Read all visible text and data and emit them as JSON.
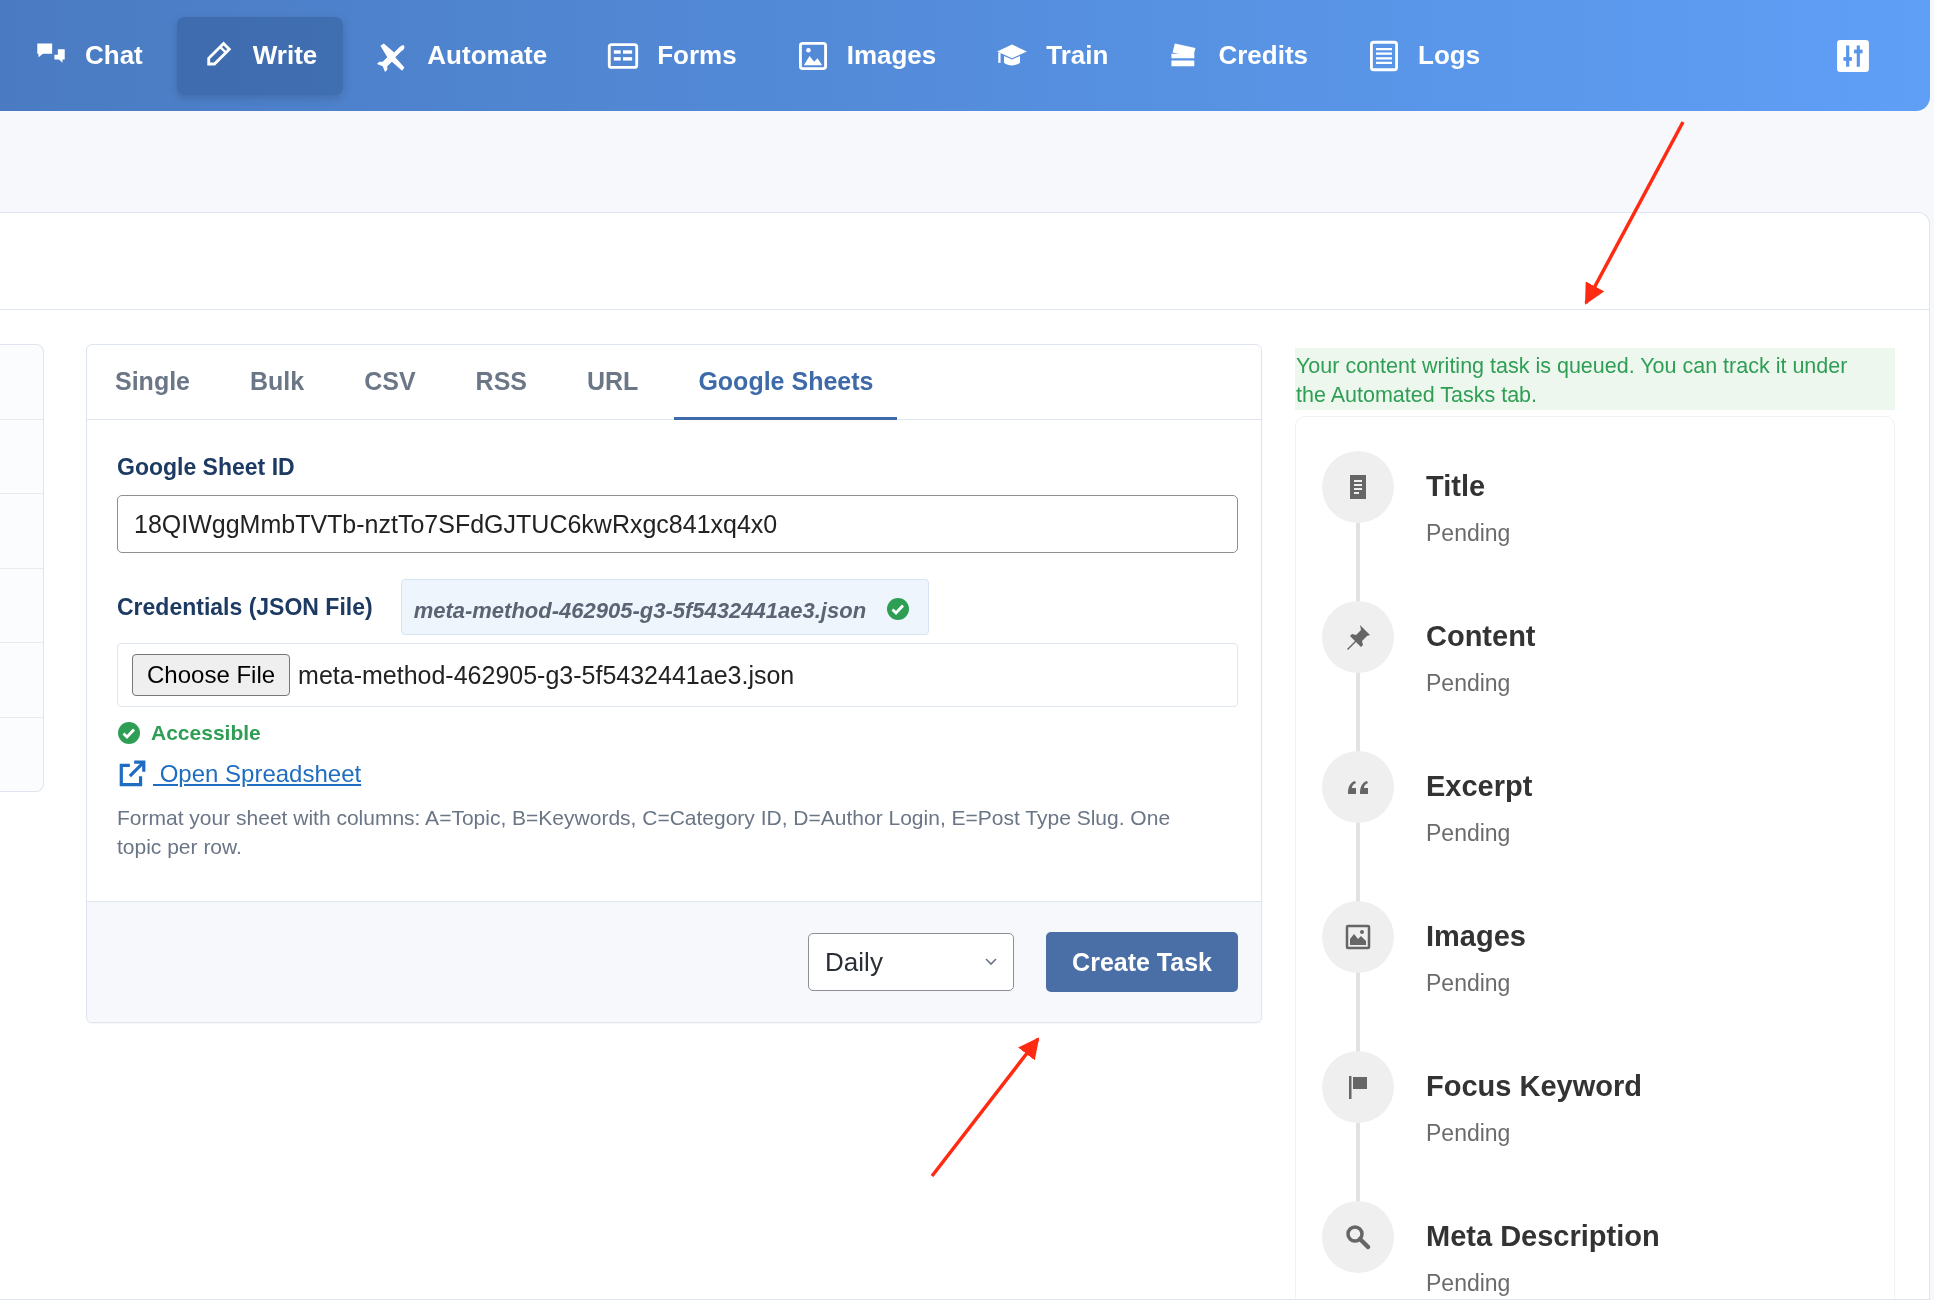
{
  "nav": {
    "items": [
      {
        "label": "Chat",
        "selected": false
      },
      {
        "label": "Write",
        "selected": true
      },
      {
        "label": "Automate",
        "selected": false
      },
      {
        "label": "Forms",
        "selected": false
      },
      {
        "label": "Images",
        "selected": false
      },
      {
        "label": "Train",
        "selected": false
      },
      {
        "label": "Credits",
        "selected": false
      },
      {
        "label": "Logs",
        "selected": false
      }
    ]
  },
  "form": {
    "tabs": [
      {
        "label": "Single",
        "selected": false
      },
      {
        "label": "Bulk",
        "selected": false
      },
      {
        "label": "CSV",
        "selected": false
      },
      {
        "label": "RSS",
        "selected": false
      },
      {
        "label": "URL",
        "selected": false
      },
      {
        "label": "Google Sheets",
        "selected": true
      }
    ],
    "sheet_id": {
      "label": "Google Sheet ID",
      "value": "18QIWggMmbTVTb-nztTo7SFdGJTUC6kwRxgc841xq4x0"
    },
    "credentials": {
      "label": "Credentials (JSON File)",
      "saved_file": "meta-method-462905-g3-5f5432441ae3.json",
      "verified": true,
      "file_button": "Choose File",
      "file_name": "meta-method-462905-g3-5f5432441ae3.json"
    },
    "access_status": {
      "text": "Accessible",
      "ok": true
    },
    "link": "Open Spreadsheet",
    "help": "Format your sheet with columns: A=Topic, B=Keywords, C=Category ID, D=Author Login, E=Post Type Slug. One topic per row.",
    "schedule": {
      "value": "Daily"
    },
    "submit": "Create Task"
  },
  "notice": "Your content writing task is queued. You can track it under the Automated Tasks tab.",
  "steps": [
    {
      "title": "Title",
      "status": "Pending"
    },
    {
      "title": "Content",
      "status": "Pending"
    },
    {
      "title": "Excerpt",
      "status": "Pending"
    },
    {
      "title": "Images",
      "status": "Pending"
    },
    {
      "title": "Focus Keyword",
      "status": "Pending"
    },
    {
      "title": "Meta Description",
      "status": "Pending"
    }
  ]
}
